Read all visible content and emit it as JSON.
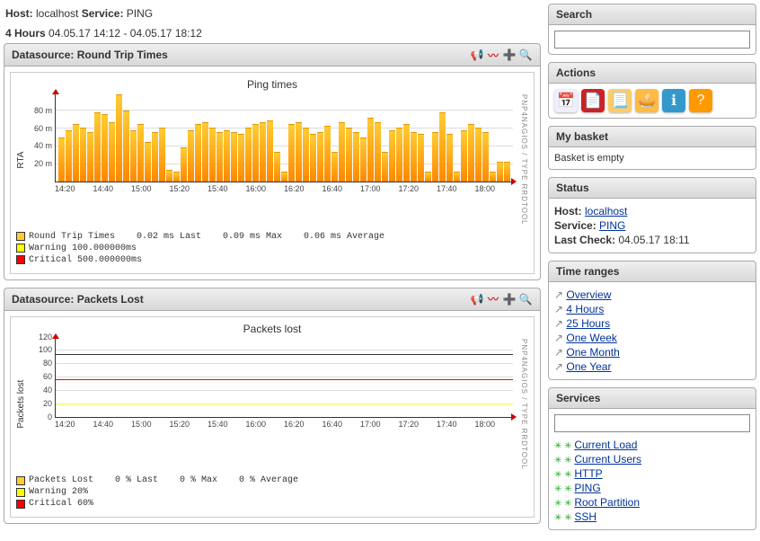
{
  "header": {
    "host_label": "Host:",
    "host": "localhost",
    "service_label": "Service:",
    "service": "PING",
    "range_label": "4 Hours",
    "range_value": "04.05.17 14:12 - 04.05.17 18:12"
  },
  "chart1": {
    "panel_title": "Datasource: Round Trip Times",
    "title": "Ping times",
    "ylabel": "RTA",
    "right_note": "PNP4NAGIOS / TYPE RRDTOOL",
    "legend_main": "Round Trip Times",
    "stat_last": "0.02 ms Last",
    "stat_max": "0.09 ms Max",
    "stat_avg": "0.06 ms Average",
    "legend_warn": "Warning  100.000000ms",
    "legend_crit": "Critical 500.000000ms"
  },
  "chart2": {
    "panel_title": "Datasource: Packets Lost",
    "title": "Packets lost",
    "ylabel": "Packets lost",
    "right_note": "PNP4NAGIOS / TYPE RRDTOOL",
    "legend_main": "Packets Lost",
    "stat_last": "0 % Last",
    "stat_max": "0 % Max",
    "stat_avg": "0 % Average",
    "legend_warn": "Warning  20%",
    "legend_crit": "Critical 60%"
  },
  "sidebar": {
    "search_title": "Search",
    "actions_title": "Actions",
    "basket_title": "My basket",
    "basket_empty": "Basket is empty",
    "status_title": "Status",
    "status_host_label": "Host:",
    "status_host": "localhost",
    "status_service_label": "Service:",
    "status_service": "PING",
    "status_lastcheck_label": "Last Check:",
    "status_lastcheck": "04.05.17 18:11",
    "timeranges_title": "Time ranges",
    "timeranges": [
      "Overview",
      "4 Hours",
      "25 Hours",
      "One Week",
      "One Month",
      "One Year"
    ],
    "services_title": "Services",
    "services": [
      "Current Load",
      "Current Users",
      "HTTP",
      "PING",
      "Root Partition",
      "SSH"
    ]
  },
  "chart_data": [
    {
      "type": "bar",
      "title": "Ping times",
      "ylabel": "RTA",
      "xlabel": "",
      "ylim": [
        0,
        90
      ],
      "yticks": [
        "20 m",
        "40 m",
        "60 m",
        "80 m"
      ],
      "xticks": [
        "14:20",
        "14:40",
        "15:00",
        "15:20",
        "15:40",
        "16:00",
        "16:20",
        "16:40",
        "17:00",
        "17:20",
        "17:40",
        "18:00"
      ],
      "values_m": [
        45,
        52,
        58,
        55,
        50,
        70,
        68,
        60,
        88,
        72,
        52,
        58,
        40,
        50,
        55,
        12,
        10,
        35,
        52,
        58,
        60,
        55,
        50,
        52,
        50,
        48,
        55,
        58,
        60,
        62,
        30,
        10,
        58,
        60,
        55,
        48,
        50,
        56,
        30,
        60,
        55,
        50,
        45,
        65,
        60,
        30,
        52,
        55,
        58,
        50,
        48,
        10,
        50,
        70,
        48,
        10,
        52,
        58,
        55,
        50,
        10,
        20,
        20
      ],
      "legend": [
        {
          "name": "Round Trip Times",
          "color": "#ffcc33",
          "last": "0.02 ms",
          "max": "0.09 ms",
          "avg": "0.06 ms"
        },
        {
          "name": "Warning",
          "color": "#ffff00",
          "threshold": "100.000000ms"
        },
        {
          "name": "Critical",
          "color": "#ff0000",
          "threshold": "500.000000ms"
        }
      ]
    },
    {
      "type": "line",
      "title": "Packets lost",
      "ylabel": "Packets lost",
      "xlabel": "",
      "ylim": [
        0,
        130
      ],
      "yticks": [
        "0",
        "20",
        "40",
        "60",
        "80",
        "100",
        "120"
      ],
      "xticks": [
        "14:20",
        "14:40",
        "15:00",
        "15:20",
        "15:40",
        "16:00",
        "16:20",
        "16:40",
        "17:00",
        "17:20",
        "17:40",
        "18:00"
      ],
      "series": [
        {
          "name": "Packets Lost",
          "color": "#333333",
          "constant_value": 100
        },
        {
          "name": "Warning",
          "color": "#ffff00",
          "constant_value": 20
        },
        {
          "name": "Critical",
          "color": "#ff0000",
          "constant_value": 60
        }
      ],
      "legend": [
        {
          "name": "Packets Lost",
          "color": "#ffcc33",
          "last": "0 %",
          "max": "0 %",
          "avg": "0 %"
        },
        {
          "name": "Warning",
          "color": "#ffff00",
          "threshold": "20%"
        },
        {
          "name": "Critical",
          "color": "#ff0000",
          "threshold": "60%"
        }
      ]
    }
  ],
  "colors": {
    "bar_fill": "#ff9900",
    "warning": "#ffff00",
    "critical": "#ff0000",
    "swatch_main": "#ffcc33"
  }
}
